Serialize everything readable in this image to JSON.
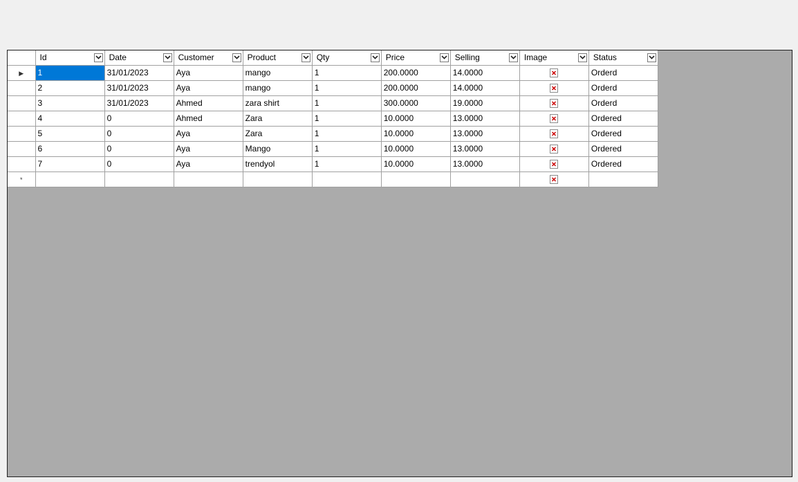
{
  "grid": {
    "columns": [
      {
        "key": "id",
        "label": "Id"
      },
      {
        "key": "date",
        "label": "Date"
      },
      {
        "key": "customer",
        "label": "Customer"
      },
      {
        "key": "product",
        "label": "Product"
      },
      {
        "key": "qty",
        "label": "Qty"
      },
      {
        "key": "price",
        "label": "Price"
      },
      {
        "key": "selling",
        "label": "Selling"
      },
      {
        "key": "image",
        "label": "Image"
      },
      {
        "key": "status",
        "label": "Status"
      }
    ],
    "rows": [
      {
        "id": "1",
        "date": "31/01/2023",
        "customer": "Aya",
        "product": "mango",
        "qty": "1",
        "price": "200.0000",
        "selling": "14.0000",
        "status": "Orderd"
      },
      {
        "id": "2",
        "date": "31/01/2023",
        "customer": "Aya",
        "product": "mango",
        "qty": "1",
        "price": "200.0000",
        "selling": "14.0000",
        "status": "Orderd"
      },
      {
        "id": "3",
        "date": "31/01/2023",
        "customer": "Ahmed",
        "product": "zara shirt",
        "qty": "1",
        "price": "300.0000",
        "selling": "19.0000",
        "status": "Orderd"
      },
      {
        "id": "4",
        "date": "0",
        "customer": "Ahmed",
        "product": "Zara",
        "qty": "1",
        "price": "10.0000",
        "selling": "13.0000",
        "status": "Ordered"
      },
      {
        "id": "5",
        "date": "0",
        "customer": "Aya",
        "product": "Zara",
        "qty": "1",
        "price": "10.0000",
        "selling": "13.0000",
        "status": "Ordered"
      },
      {
        "id": "6",
        "date": "0",
        "customer": "Aya",
        "product": "Mango",
        "qty": "1",
        "price": "10.0000",
        "selling": "13.0000",
        "status": "Ordered"
      },
      {
        "id": "7",
        "date": "0",
        "customer": "Aya",
        "product": "trendyol",
        "qty": "1",
        "price": "10.0000",
        "selling": "13.0000",
        "status": "Ordered"
      }
    ],
    "current_row_glyph": "▶",
    "new_row_glyph": "*",
    "selected_row_index": 0,
    "selected_column": "id",
    "colors": {
      "selection": "#0078d7",
      "empty_area": "#ababab",
      "broken_image_x": "#cc0000"
    }
  }
}
